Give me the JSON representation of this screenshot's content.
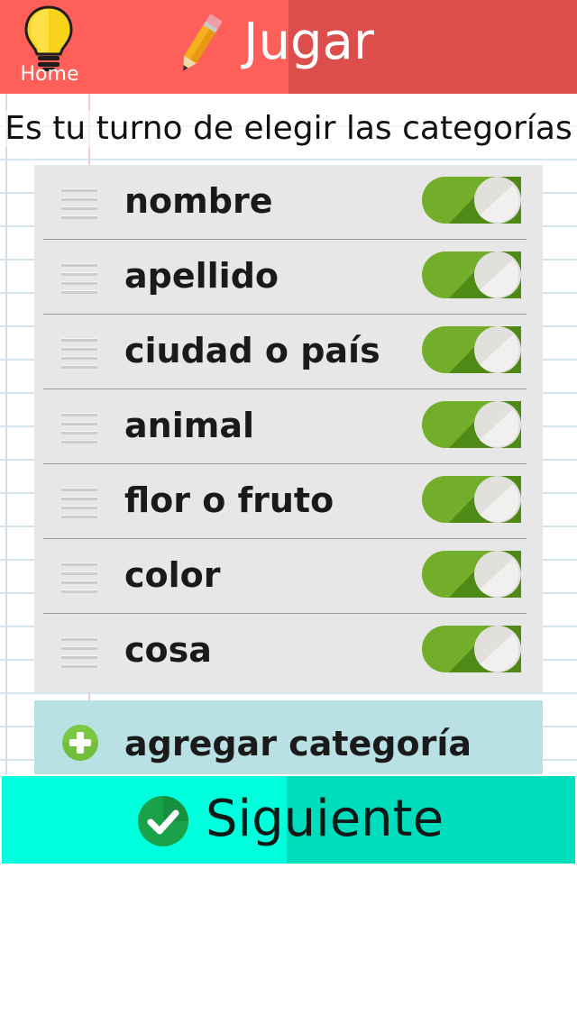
{
  "header": {
    "home_label": "Home",
    "title": "Jugar",
    "bg_color": "#ff5f59",
    "shade_color": "#dc4e4c",
    "icons": [
      "lightbulb-icon",
      "pencil-icon"
    ]
  },
  "prompt": "Es tu turno de elegir las categorías",
  "categories": [
    {
      "label": "nombre",
      "enabled": true
    },
    {
      "label": "apellido",
      "enabled": true
    },
    {
      "label": "ciudad o país",
      "enabled": true
    },
    {
      "label": "animal",
      "enabled": true
    },
    {
      "label": "flor o fruto",
      "enabled": true
    },
    {
      "label": "color",
      "enabled": true
    },
    {
      "label": "cosa",
      "enabled": true
    }
  ],
  "toggle_on_color": "#72ae2a",
  "add_category": {
    "label": "agregar categoría",
    "icon": "plus-circle-icon",
    "bg_color": "#b9e0e3"
  },
  "next_button": {
    "label": "Siguiente",
    "icon": "check-circle-icon",
    "bg_color": "#00ffdd"
  }
}
